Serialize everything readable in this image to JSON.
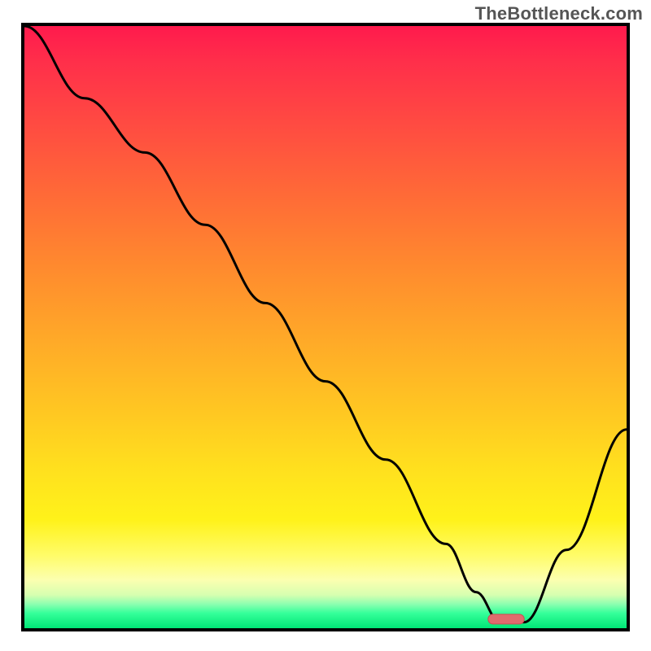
{
  "watermark": "TheBottleneck.com",
  "chart_data": {
    "type": "line",
    "title": "",
    "xlabel": "",
    "ylabel": "",
    "xlim": [
      0,
      100
    ],
    "ylim": [
      0,
      100
    ],
    "note": "No axis ticks or labels are shown. x/y are relative percentages of the plot box; y is the visual bottleneck/error magnitude (0 = green minimum at bottom, 100 = red maximum at top).",
    "series": [
      {
        "name": "bottleneck-curve",
        "x": [
          0,
          10,
          20,
          30,
          40,
          50,
          60,
          70,
          75,
          79,
          83,
          90,
          100
        ],
        "y": [
          100,
          88,
          79,
          67,
          54,
          41,
          28,
          14,
          6,
          1,
          1,
          13,
          33
        ]
      }
    ],
    "marker": {
      "name": "optimal-range",
      "x_start": 77,
      "x_end": 83,
      "y": 1.5,
      "color": "#e06b6e"
    },
    "background_gradient": {
      "top": "#ff1a4d",
      "mid": "#ffe11e",
      "bottom": "#00e676"
    }
  }
}
